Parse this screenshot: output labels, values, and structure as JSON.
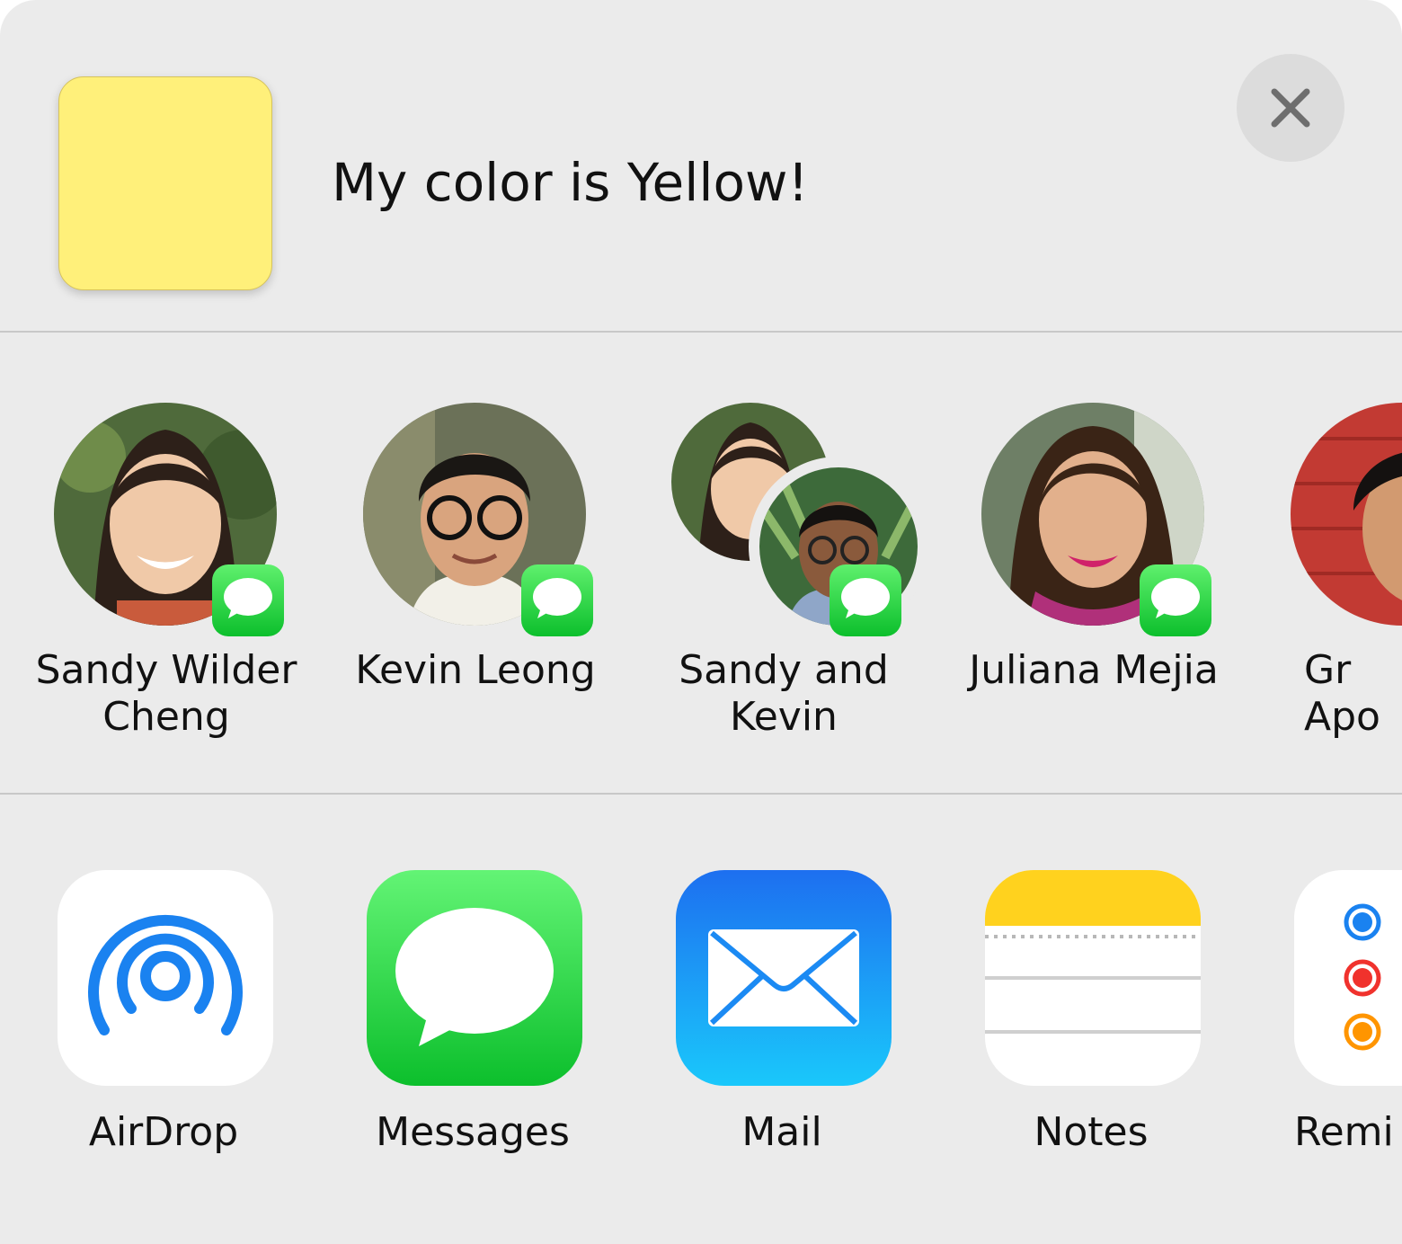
{
  "header": {
    "title": "My color is Yellow!",
    "thumbnail_color": "#fff07a",
    "close_icon": "close-icon"
  },
  "people": [
    {
      "name": "Sandy Wilder Cheng",
      "badge_icon": "messages-badge-icon"
    },
    {
      "name": "Kevin Leong",
      "badge_icon": "messages-badge-icon"
    },
    {
      "name": "Sandy and Kevin",
      "badge_icon": "messages-badge-icon"
    },
    {
      "name": "Juliana Mejia",
      "badge_icon": "messages-badge-icon"
    },
    {
      "name": "Gr Apo",
      "badge_icon": ""
    }
  ],
  "apps": [
    {
      "label": "AirDrop",
      "icon": "airdrop-icon"
    },
    {
      "label": "Messages",
      "icon": "messages-icon"
    },
    {
      "label": "Mail",
      "icon": "mail-icon"
    },
    {
      "label": "Notes",
      "icon": "notes-icon"
    },
    {
      "label": "Remi",
      "icon": "reminders-icon"
    }
  ],
  "colors": {
    "messages_green": "#0cbf2c",
    "airdrop_blue": "#1a82f0",
    "mail_blue": "#1b8af3",
    "notes_yellow": "#ffd21e"
  }
}
